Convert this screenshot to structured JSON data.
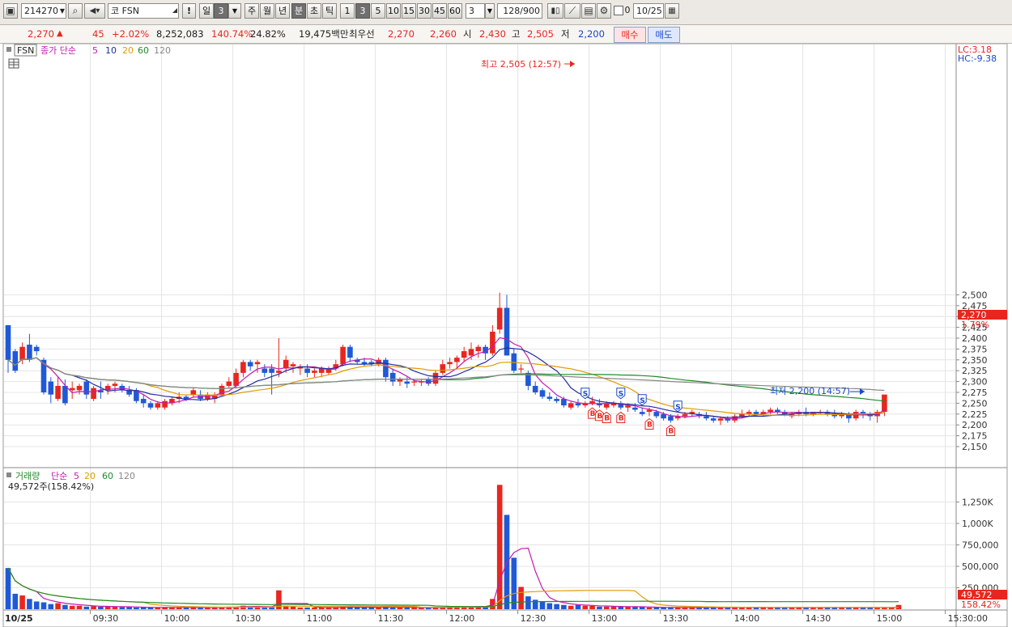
{
  "toolbar": {
    "code": "214270",
    "market_icon": "코",
    "stock_name": "FSN",
    "alert": "!",
    "period_buttons": [
      "일",
      "3",
      "주",
      "월",
      "년",
      "분",
      "초",
      "틱"
    ],
    "intervals": [
      "1",
      "3",
      "5",
      "10",
      "15",
      "30",
      "45",
      "60"
    ],
    "interval_value": "3",
    "count": "128/900",
    "date": "10/25",
    "checkbox_label": "0"
  },
  "quote": {
    "price": "2,270",
    "change": "45",
    "change_rate": "+2.02%",
    "volume": "8,252,083",
    "volume_ratio": "140.74%",
    "turnover": "24.82%",
    "amount": "19,475백만",
    "best_label": "최우선",
    "best_ask": "2,270",
    "best_bid": "2,260",
    "open_label": "시",
    "open": "2,430",
    "high_label": "고",
    "high": "2,505",
    "low_label": "저",
    "low": "2,200",
    "buy": "매수",
    "sell": "매도"
  },
  "price_panel": {
    "symbol": "FSN",
    "legend": [
      "종가 단순",
      "5",
      "10",
      "20",
      "60",
      "120"
    ],
    "lc": "LC:3.18",
    "hc": "HC:-9.38",
    "current_price_tag": "2,270",
    "current_pct_tag": "1.79%",
    "high_annotation": "최고 2,505 (12:57)",
    "low_annotation": "최저 2,200 (14:57)",
    "signal_b": "B",
    "signal_s": "S"
  },
  "volume_panel": {
    "legend": [
      "거래량",
      "단순",
      "5",
      "20",
      "60",
      "120"
    ],
    "info": "49,572주(158.42%)",
    "current_tag": "49,572",
    "current_pct": "158.42%"
  },
  "x_axis": {
    "date_label": "10/25"
  },
  "chart_data": {
    "type": "candlestick",
    "price_axis_ticks": [
      2150,
      2175,
      2200,
      2225,
      2250,
      2275,
      2300,
      2325,
      2350,
      2375,
      2400,
      2425,
      2450,
      2475,
      2500
    ],
    "price_axis_labels": [
      "2,150",
      "2,175",
      "2,200",
      "2,225",
      "2,250",
      "2,275",
      "2,300",
      "2,325",
      "2,350",
      "2,375",
      "2,400",
      "2,425",
      "2,450",
      "2,475",
      "2,500"
    ],
    "volume_axis_ticks": [
      250000,
      500000,
      750000,
      1000000,
      1250000
    ],
    "volume_axis_labels": [
      "250,000",
      "500,000",
      "750,000",
      "1,000K",
      "1,250K"
    ],
    "time_labels": [
      "09:30",
      "10:00",
      "10:30",
      "11:00",
      "11:30",
      "12:00",
      "12:30",
      "13:00",
      "13:30",
      "14:00",
      "14:30",
      "15:00",
      "15:30:00"
    ],
    "time_label_bars": [
      12,
      22,
      32,
      42,
      52,
      62,
      72,
      82,
      92,
      102,
      112,
      122,
      132
    ],
    "candles": [
      [
        2430,
        2430,
        2320,
        2350
      ],
      [
        2370,
        2375,
        2320,
        2325
      ],
      [
        2350,
        2390,
        2340,
        2380
      ],
      [
        2385,
        2410,
        2345,
        2350
      ],
      [
        2380,
        2385,
        2360,
        2370
      ],
      [
        2350,
        2355,
        2270,
        2275
      ],
      [
        2300,
        2310,
        2250,
        2270
      ],
      [
        2260,
        2310,
        2255,
        2290
      ],
      [
        2290,
        2305,
        2245,
        2250
      ],
      [
        2280,
        2300,
        2260,
        2285
      ],
      [
        2280,
        2295,
        2270,
        2290
      ],
      [
        2300,
        2305,
        2260,
        2270
      ],
      [
        2260,
        2290,
        2255,
        2285
      ],
      [
        2280,
        2300,
        2260,
        2275
      ],
      [
        2280,
        2295,
        2270,
        2290
      ],
      [
        2290,
        2300,
        2275,
        2295
      ],
      [
        2290,
        2295,
        2275,
        2280
      ],
      [
        2280,
        2290,
        2265,
        2270
      ],
      [
        2280,
        2285,
        2250,
        2255
      ],
      [
        2260,
        2270,
        2240,
        2250
      ],
      [
        2250,
        2255,
        2235,
        2240
      ],
      [
        2240,
        2255,
        2235,
        2250
      ],
      [
        2240,
        2260,
        2235,
        2255
      ],
      [
        2250,
        2265,
        2245,
        2260
      ],
      [
        2260,
        2275,
        2250,
        2265
      ],
      [
        2265,
        2270,
        2255,
        2260
      ],
      [
        2270,
        2285,
        2265,
        2280
      ],
      [
        2270,
        2280,
        2255,
        2260
      ],
      [
        2260,
        2275,
        2255,
        2270
      ],
      [
        2260,
        2275,
        2250,
        2270
      ],
      [
        2270,
        2295,
        2265,
        2290
      ],
      [
        2290,
        2310,
        2285,
        2300
      ],
      [
        2290,
        2330,
        2285,
        2320
      ],
      [
        2320,
        2350,
        2310,
        2345
      ],
      [
        2345,
        2350,
        2325,
        2335
      ],
      [
        2340,
        2350,
        2320,
        2345
      ],
      [
        2330,
        2340,
        2310,
        2320
      ],
      [
        2330,
        2340,
        2270,
        2320
      ],
      [
        2320,
        2400,
        2310,
        2325
      ],
      [
        2330,
        2360,
        2320,
        2350
      ],
      [
        2335,
        2345,
        2320,
        2340
      ],
      [
        2330,
        2340,
        2315,
        2335
      ],
      [
        2330,
        2340,
        2310,
        2320
      ],
      [
        2320,
        2330,
        2310,
        2325
      ],
      [
        2320,
        2335,
        2310,
        2330
      ],
      [
        2320,
        2335,
        2315,
        2330
      ],
      [
        2330,
        2350,
        2325,
        2340
      ],
      [
        2340,
        2385,
        2335,
        2380
      ],
      [
        2380,
        2385,
        2345,
        2355
      ],
      [
        2350,
        2355,
        2340,
        2345
      ],
      [
        2345,
        2355,
        2335,
        2340
      ],
      [
        2345,
        2350,
        2335,
        2340
      ],
      [
        2340,
        2355,
        2335,
        2350
      ],
      [
        2350,
        2355,
        2300,
        2310
      ],
      [
        2320,
        2330,
        2290,
        2300
      ],
      [
        2300,
        2310,
        2290,
        2305
      ],
      [
        2300,
        2310,
        2285,
        2295
      ],
      [
        2300,
        2305,
        2290,
        2300
      ],
      [
        2300,
        2305,
        2290,
        2300
      ],
      [
        2305,
        2310,
        2290,
        2295
      ],
      [
        2295,
        2325,
        2290,
        2320
      ],
      [
        2320,
        2350,
        2315,
        2340
      ],
      [
        2340,
        2355,
        2330,
        2345
      ],
      [
        2345,
        2360,
        2330,
        2355
      ],
      [
        2355,
        2380,
        2345,
        2370
      ],
      [
        2360,
        2390,
        2350,
        2375
      ],
      [
        2370,
        2385,
        2355,
        2380
      ],
      [
        2380,
        2385,
        2350,
        2365
      ],
      [
        2365,
        2430,
        2360,
        2415
      ],
      [
        2420,
        2505,
        2410,
        2470
      ],
      [
        2470,
        2500,
        2360,
        2360
      ],
      [
        2365,
        2375,
        2320,
        2325
      ],
      [
        2330,
        2340,
        2320,
        2330
      ],
      [
        2320,
        2325,
        2280,
        2290
      ],
      [
        2290,
        2300,
        2270,
        2275
      ],
      [
        2280,
        2285,
        2260,
        2265
      ],
      [
        2265,
        2275,
        2255,
        2260
      ],
      [
        2260,
        2265,
        2250,
        2255
      ],
      [
        2260,
        2265,
        2240,
        2245
      ],
      [
        2240,
        2255,
        2235,
        2250
      ],
      [
        2250,
        2260,
        2240,
        2245
      ],
      [
        2245,
        2255,
        2240,
        2250
      ],
      [
        2250,
        2265,
        2245,
        2255
      ],
      [
        2250,
        2260,
        2240,
        2245
      ],
      [
        2240,
        2255,
        2235,
        2250
      ],
      [
        2245,
        2255,
        2240,
        2250
      ],
      [
        2250,
        2255,
        2235,
        2240
      ],
      [
        2240,
        2250,
        2230,
        2245
      ],
      [
        2240,
        2250,
        2230,
        2235
      ],
      [
        2230,
        2240,
        2220,
        2225
      ],
      [
        2230,
        2240,
        2220,
        2235
      ],
      [
        2230,
        2235,
        2215,
        2220
      ],
      [
        2225,
        2230,
        2210,
        2215
      ],
      [
        2220,
        2225,
        2205,
        2210
      ],
      [
        2215,
        2225,
        2210,
        2220
      ],
      [
        2220,
        2230,
        2215,
        2225
      ],
      [
        2225,
        2235,
        2220,
        2230
      ],
      [
        2225,
        2230,
        2215,
        2220
      ],
      [
        2220,
        2230,
        2210,
        2215
      ],
      [
        2215,
        2220,
        2205,
        2210
      ],
      [
        2210,
        2220,
        2200,
        2215
      ],
      [
        2215,
        2220,
        2205,
        2210
      ],
      [
        2210,
        2225,
        2205,
        2220
      ],
      [
        2220,
        2235,
        2215,
        2225
      ],
      [
        2225,
        2235,
        2220,
        2230
      ],
      [
        2230,
        2235,
        2220,
        2225
      ],
      [
        2225,
        2235,
        2220,
        2230
      ],
      [
        2230,
        2240,
        2225,
        2235
      ],
      [
        2235,
        2240,
        2225,
        2230
      ],
      [
        2230,
        2235,
        2220,
        2225
      ],
      [
        2220,
        2230,
        2215,
        2225
      ],
      [
        2225,
        2235,
        2220,
        2230
      ],
      [
        2230,
        2240,
        2220,
        2225
      ],
      [
        2225,
        2230,
        2220,
        2230
      ],
      [
        2230,
        2235,
        2225,
        2230
      ],
      [
        2230,
        2235,
        2220,
        2225
      ],
      [
        2225,
        2235,
        2215,
        2220
      ],
      [
        2220,
        2230,
        2215,
        2225
      ],
      [
        2225,
        2230,
        2205,
        2215
      ],
      [
        2215,
        2235,
        2210,
        2230
      ],
      [
        2230,
        2235,
        2215,
        2225
      ],
      [
        2225,
        2230,
        2210,
        2220
      ],
      [
        2220,
        2235,
        2205,
        2230
      ],
      [
        2230,
        2240,
        2220,
        2270
      ]
    ],
    "volumes": [
      480000,
      180000,
      160000,
      120000,
      90000,
      80000,
      60000,
      70000,
      50000,
      40000,
      40000,
      30000,
      35000,
      30000,
      30000,
      30000,
      25000,
      25000,
      20000,
      20000,
      20000,
      20000,
      25000,
      20000,
      20000,
      20000,
      20000,
      20000,
      20000,
      20000,
      25000,
      30000,
      30000,
      40000,
      30000,
      30000,
      20000,
      20000,
      220000,
      40000,
      30000,
      20000,
      20000,
      20000,
      20000,
      20000,
      20000,
      30000,
      30000,
      20000,
      20000,
      20000,
      20000,
      30000,
      20000,
      20000,
      20000,
      20000,
      15000,
      20000,
      20000,
      25000,
      30000,
      30000,
      35000,
      30000,
      30000,
      30000,
      120000,
      1450000,
      1100000,
      600000,
      260000,
      150000,
      110000,
      90000,
      70000,
      60000,
      50000,
      40000,
      50000,
      40000,
      40000,
      30000,
      30000,
      30000,
      30000,
      30000,
      25000,
      25000,
      20000,
      20000,
      20000,
      20000,
      20000,
      20000,
      20000,
      20000,
      20000,
      20000,
      20000,
      20000,
      25000,
      25000,
      20000,
      20000,
      20000,
      20000,
      20000,
      20000,
      20000,
      20000,
      20000,
      20000,
      20000,
      20000,
      20000,
      20000,
      20000,
      20000,
      20000,
      20000,
      20000,
      20000,
      20000,
      49572
    ]
  }
}
